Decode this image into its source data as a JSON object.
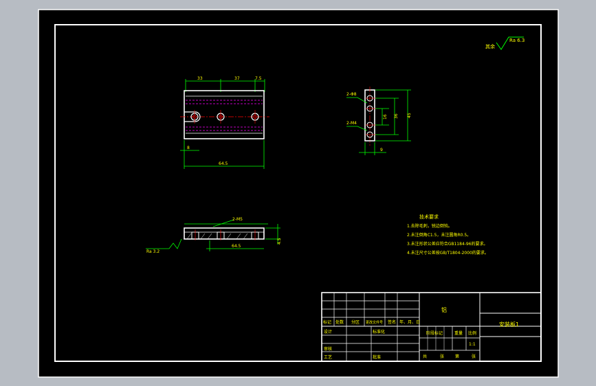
{
  "colors": {
    "desktop": "#b7bcc3",
    "sheet": "#000000",
    "border": "#ffffff",
    "dimension": "#00ff00",
    "text": "#ffff00",
    "hidden_line": "#ff00ff",
    "center_line": "#ff0000",
    "title_text": "#ffff00",
    "table_line": "#ffffff"
  },
  "surface_note": {
    "prefix": "其余",
    "value": "Ra 6.3"
  },
  "top_view": {
    "dim_a": "33",
    "dim_b": "37",
    "dim_c": "7.5",
    "dim_left": "8",
    "dim_width": "64.5"
  },
  "side_view": {
    "hole_a": "2-Φ8",
    "hole_b": "2-M4",
    "dim_inner": "16",
    "dim_mid": "36",
    "dim_outer": "45",
    "dim_bottom": "9"
  },
  "section_view": {
    "hole_label": "2-M5",
    "roughness": "Ra 3.2",
    "dim_width": "64.5",
    "dim_height": "4.5"
  },
  "requirements": {
    "title": "技术要求",
    "items": [
      "1.去除毛刺，锐边倒钝。",
      "2.未注倒角C1.5，未注圆角R0.5。",
      "3.未注形状公差应符合GB1184-96的要求。",
      "4.未注尺寸公差按GB/T1804-2000的要求。"
    ]
  },
  "title_block": {
    "material": "铝",
    "part_name": "安装板1",
    "row_labels": [
      "标记",
      "处数",
      "分区",
      "更改文件号",
      "签名",
      "年、月、日"
    ],
    "design": "设计",
    "standard": "标准化",
    "review": "审核",
    "process": "工艺",
    "approve": "批准",
    "stage_mark": "阶段标记",
    "weight": "重量",
    "scale": "比例",
    "scale_value": "1:1",
    "sheet_total": "共",
    "sheet_unit_a": "张",
    "sheet_no": "第",
    "sheet_unit_b": "张"
  }
}
